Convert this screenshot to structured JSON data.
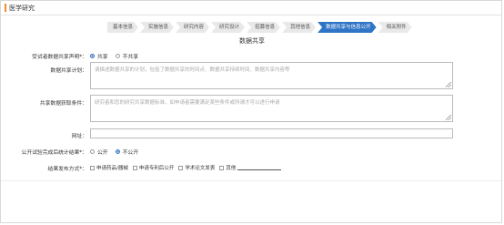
{
  "header": {
    "title": "医学研究"
  },
  "steps": [
    "基本信息",
    "实施信息",
    "研究内容",
    "研究设计",
    "招募信息",
    "其他信息",
    "数据共享与信息公开",
    "相关附件"
  ],
  "active_step_index": 6,
  "section_title": "数据共享",
  "fields": {
    "share_statement": {
      "label": "受试者数据共享声明*：",
      "options": [
        "共享",
        "不共享"
      ],
      "selected": "共享"
    },
    "share_plan": {
      "label": "数据共享计划：",
      "placeholder": "请描述数据共享的计划，包括了数据共享的时间点、数据共享持续时间、数据共享内容等"
    },
    "share_conditions": {
      "label": "共享数据获取条件：",
      "placeholder": "研究者和您的研究共享数据标准，如申请者需要满足某些条件或所谓才可以进行申请"
    },
    "url": {
      "label": "网址：",
      "value": ""
    },
    "publish_results": {
      "label": "公开试验完成后统计结果*：",
      "options": [
        "公开",
        "不公开"
      ],
      "selected": "不公开"
    },
    "publish_method": {
      "label": "结果发布方式*：",
      "options": [
        "申请药品/器械",
        "申请专利后公开",
        "学术论文发表",
        "其他"
      ]
    }
  },
  "colors": {
    "accent": "#2f74c6",
    "title_mark": "#f28c28"
  }
}
